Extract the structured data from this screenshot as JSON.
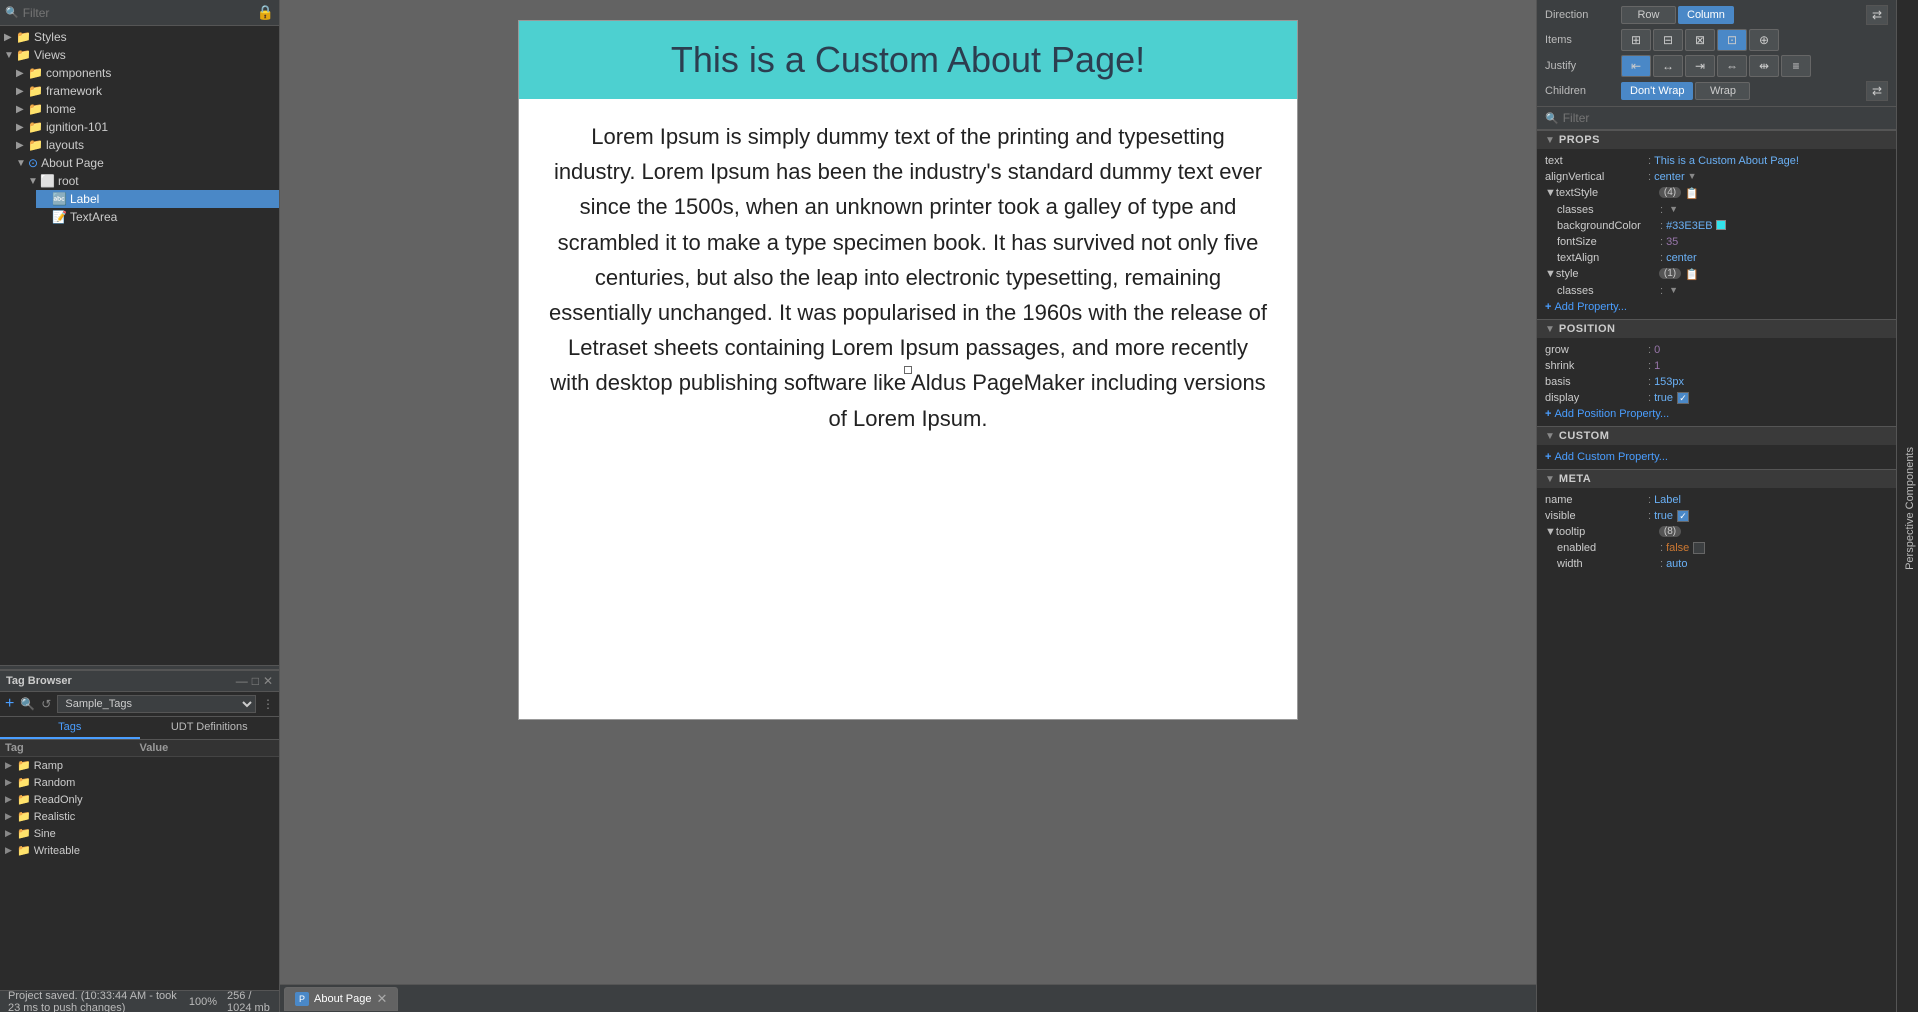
{
  "filter": {
    "placeholder": "Filter",
    "lock_icon": "🔒"
  },
  "tree": {
    "items": [
      {
        "id": "styles",
        "label": "Styles",
        "indent": 0,
        "type": "folder",
        "expanded": true
      },
      {
        "id": "views",
        "label": "Views",
        "indent": 0,
        "type": "folder",
        "expanded": true
      },
      {
        "id": "components",
        "label": "components",
        "indent": 1,
        "type": "folder",
        "expanded": false
      },
      {
        "id": "framework",
        "label": "framework",
        "indent": 1,
        "type": "folder",
        "expanded": false
      },
      {
        "id": "home",
        "label": "home",
        "indent": 1,
        "type": "folder",
        "expanded": false
      },
      {
        "id": "ignition-101",
        "label": "ignition-101",
        "indent": 1,
        "type": "folder",
        "expanded": false
      },
      {
        "id": "layouts",
        "label": "layouts",
        "indent": 1,
        "type": "folder",
        "expanded": false
      },
      {
        "id": "about-page",
        "label": "About Page",
        "indent": 1,
        "type": "page",
        "expanded": true
      },
      {
        "id": "root",
        "label": "root",
        "indent": 2,
        "type": "component",
        "expanded": true
      },
      {
        "id": "label",
        "label": "Label",
        "indent": 3,
        "type": "label",
        "selected": true
      },
      {
        "id": "textarea",
        "label": "TextArea",
        "indent": 3,
        "type": "label"
      }
    ]
  },
  "tag_browser": {
    "title": "Tag Browser",
    "source": "Sample_Tags",
    "tabs": [
      "Tags",
      "UDT Definitions"
    ],
    "active_tab": "Tags",
    "columns": [
      "Tag",
      "Value"
    ],
    "items": [
      {
        "label": "Ramp",
        "indent": 0
      },
      {
        "label": "Random",
        "indent": 0
      },
      {
        "label": "ReadOnly",
        "indent": 0
      },
      {
        "label": "Realistic",
        "indent": 0
      },
      {
        "label": "Sine",
        "indent": 0
      },
      {
        "label": "Writeable",
        "indent": 0
      }
    ]
  },
  "status_bar": {
    "message": "Project saved. (10:33:44 AM - took 23 ms to push changes)"
  },
  "canvas": {
    "header_text": "This is a Custom About Page!",
    "body_text": "Lorem Ipsum is simply dummy text of the printing and typesetting industry. Lorem Ipsum has been the industry's standard dummy text ever since the 1500s, when an unknown printer took a galley of type and scrambled it to make a type specimen book. It has survived not only five centuries, but also the leap into electronic typesetting, remaining essentially unchanged. It was popularised in the 1960s with the release of Letraset sheets containing Lorem Ipsum passages, and more recently with desktop publishing software like Aldus PageMaker including versions of Lorem Ipsum.",
    "tab_label": "About Page"
  },
  "right_panel": {
    "direction_label": "Direction",
    "direction_options": [
      "Row",
      "Column"
    ],
    "direction_active": "Column",
    "items_label": "Items",
    "justify_label": "Justify",
    "children_label": "Children",
    "children_options": [
      "Don't Wrap",
      "Wrap"
    ],
    "children_active": "Don't Wrap",
    "filter_placeholder": "Filter",
    "sections": {
      "props": {
        "title": "PROPS",
        "items": [
          {
            "key": "text",
            "val": "This is a Custom About Page!",
            "type": "string"
          },
          {
            "key": "alignVertical",
            "val": "center",
            "type": "string"
          },
          {
            "key": "textStyle",
            "badge": "(4)",
            "type": "group",
            "children": [
              {
                "key": "classes",
                "val": "",
                "type": "string"
              },
              {
                "key": "backgroundColor",
                "val": "#33E3EB",
                "type": "color",
                "color": "#33E3EB"
              },
              {
                "key": "fontSize",
                "val": "35",
                "type": "number"
              },
              {
                "key": "textAlign",
                "val": "center",
                "type": "string"
              }
            ]
          },
          {
            "key": "style",
            "badge": "(1)",
            "type": "group",
            "children": [
              {
                "key": "classes",
                "val": "",
                "type": "string"
              }
            ]
          }
        ]
      },
      "position": {
        "title": "POSITION",
        "items": [
          {
            "key": "grow",
            "val": "0",
            "type": "number"
          },
          {
            "key": "shrink",
            "val": "1",
            "type": "number"
          },
          {
            "key": "basis",
            "val": "153px",
            "type": "string"
          },
          {
            "key": "display",
            "val": "true",
            "type": "bool-true"
          }
        ]
      },
      "custom": {
        "title": "CUSTOM"
      },
      "meta": {
        "title": "META",
        "items": [
          {
            "key": "name",
            "val": "Label",
            "type": "string"
          },
          {
            "key": "visible",
            "val": "true",
            "type": "bool-true"
          },
          {
            "key": "tooltip",
            "badge": "(8)",
            "type": "group",
            "children": [
              {
                "key": "enabled",
                "val": "false",
                "type": "bool-false"
              },
              {
                "key": "width",
                "val": "auto",
                "type": "string"
              }
            ]
          }
        ]
      }
    }
  },
  "far_right": {
    "label": "Perspective Components"
  },
  "zoom": "100%",
  "memory": "256 / 1024 mb"
}
